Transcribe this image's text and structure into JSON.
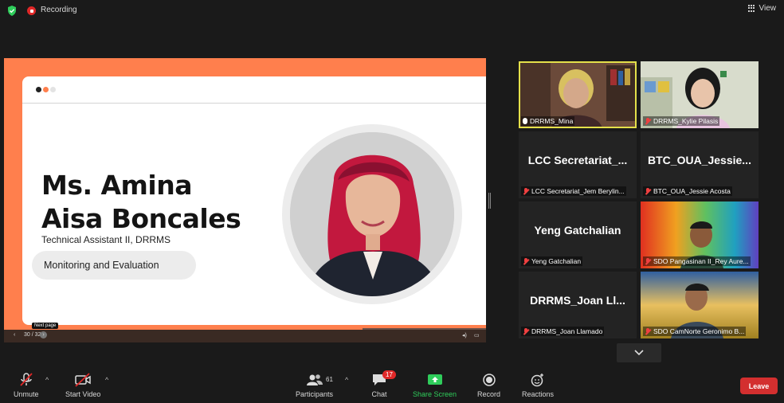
{
  "topbar": {
    "recording_label": "Recording",
    "view_label": "View"
  },
  "slide": {
    "name_line1": "Ms. Amina",
    "name_line2": "Aisa Boncales",
    "job_title": "Technical Assistant II, DRRMS",
    "pill_text": "Monitoring and Evaluation",
    "accent_color": "#ff7f4d",
    "page_indicator": "30 / 32",
    "tooltip": "Next page"
  },
  "gallery": {
    "tiles": [
      {
        "name": "DRRMS_Mina",
        "big": "",
        "muted": false,
        "active": true
      },
      {
        "name": "DRRMS_Kylie Pilasis",
        "big": "",
        "muted": true,
        "active": false
      },
      {
        "name": "LCC Secretariat_Jem Berylin...",
        "big": "LCC  Secretariat_...",
        "muted": true,
        "active": false
      },
      {
        "name": "BTC_OUA_Jessie Acosta",
        "big": "BTC_OUA_Jessie...",
        "muted": true,
        "active": false
      },
      {
        "name": "Yeng Gatchalian",
        "big": "Yeng Gatchalian",
        "muted": true,
        "active": false
      },
      {
        "name": "SDO Pangasinan II_Rey Aure...",
        "big": "",
        "muted": true,
        "active": false
      },
      {
        "name": "DRRMS_Joan Llamado",
        "big": "DRRMS_Joan  Ll...",
        "muted": true,
        "active": false
      },
      {
        "name": "SDO CamNorte Geronimo B...",
        "big": "",
        "muted": true,
        "active": false
      }
    ]
  },
  "toolbar": {
    "unmute": "Unmute",
    "start_video": "Start Video",
    "participants": "Participants",
    "participants_count": "61",
    "chat": "Chat",
    "chat_badge": "17",
    "share_screen": "Share Screen",
    "record": "Record",
    "reactions": "Reactions",
    "leave": "Leave"
  }
}
